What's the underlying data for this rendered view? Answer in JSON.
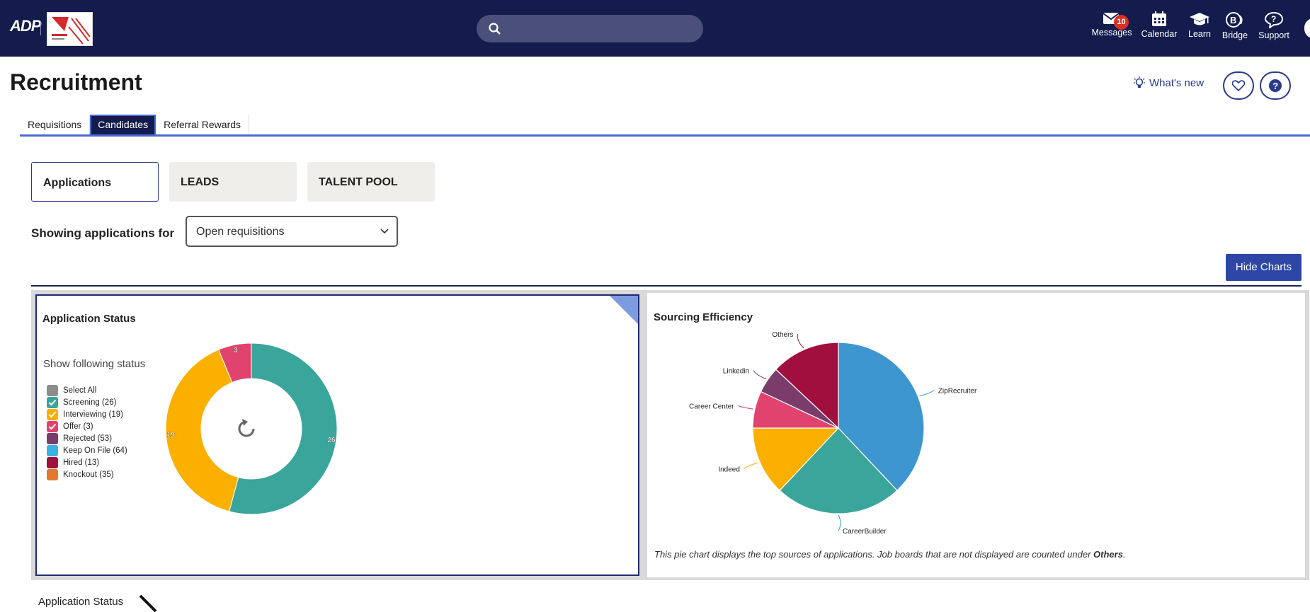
{
  "header": {
    "brand": "ADP",
    "search": {
      "placeholder": ""
    },
    "nav": [
      {
        "label": "Messages",
        "icon": "envelope-icon",
        "badge": "10"
      },
      {
        "label": "Calendar",
        "icon": "calendar-icon"
      },
      {
        "label": "Learn",
        "icon": "graduation-cap-icon"
      },
      {
        "label": "Bridge",
        "icon": "bridge-icon"
      },
      {
        "label": "Support",
        "icon": "support-icon"
      }
    ]
  },
  "page": {
    "title": "Recruitment",
    "whats_new": "What's new"
  },
  "tabs": [
    "Requisitions",
    "Candidates",
    "Referral Rewards"
  ],
  "active_tab": "Candidates",
  "subtabs": [
    "Applications",
    "LEADS",
    "TALENT POOL"
  ],
  "filter": {
    "label": "Showing applications for",
    "selected": "Open requisitions"
  },
  "hide_charts_label": "Hide Charts",
  "application_status": {
    "title": "Application Status",
    "status_heading": "Show following status",
    "legend": [
      {
        "label": "Select All",
        "color": "#8c8c8c",
        "checked": false
      },
      {
        "label": "Screening (26)",
        "color": "#3aa59b",
        "checked": true
      },
      {
        "label": "Interviewing (19)",
        "color": "#fbb000",
        "checked": true
      },
      {
        "label": "Offer (3)",
        "color": "#e0436e",
        "checked": true
      },
      {
        "label": "Rejected (53)",
        "color": "#7a3d6b",
        "checked": false
      },
      {
        "label": "Keep On File (64)",
        "color": "#3bb3e0",
        "checked": false
      },
      {
        "label": "Hired (13)",
        "color": "#a10f3f",
        "checked": false
      },
      {
        "label": "Knockout (35)",
        "color": "#e07a30",
        "checked": false
      }
    ]
  },
  "sourcing_efficiency": {
    "title": "Sourcing Efficiency",
    "note_prefix": "This pie chart displays the top sources of applications. Job boards that are not displayed are counted under ",
    "note_bold": "Others",
    "note_suffix": "."
  },
  "bottom_label": "Application Status",
  "chart_data": [
    {
      "type": "pie",
      "title": "Application Status",
      "categories": [
        "Screening",
        "Interviewing",
        "Offer"
      ],
      "values": [
        26,
        19,
        3
      ],
      "data_labels": [
        "26",
        "19",
        "3"
      ],
      "colors": [
        "#3aa59b",
        "#fbb000",
        "#e0436e"
      ],
      "donut": true
    },
    {
      "type": "pie",
      "title": "Sourcing Efficiency",
      "categories": [
        "ZipRecruiter",
        "CareerBuilder",
        "Indeed",
        "Career Center",
        "Linkedin",
        "Others"
      ],
      "values": [
        38,
        24,
        13,
        7,
        5,
        13
      ],
      "colors": [
        "#3d96d0",
        "#3aa59b",
        "#fbb000",
        "#e0436e",
        "#7a3d6b",
        "#a10f3f"
      ]
    }
  ]
}
